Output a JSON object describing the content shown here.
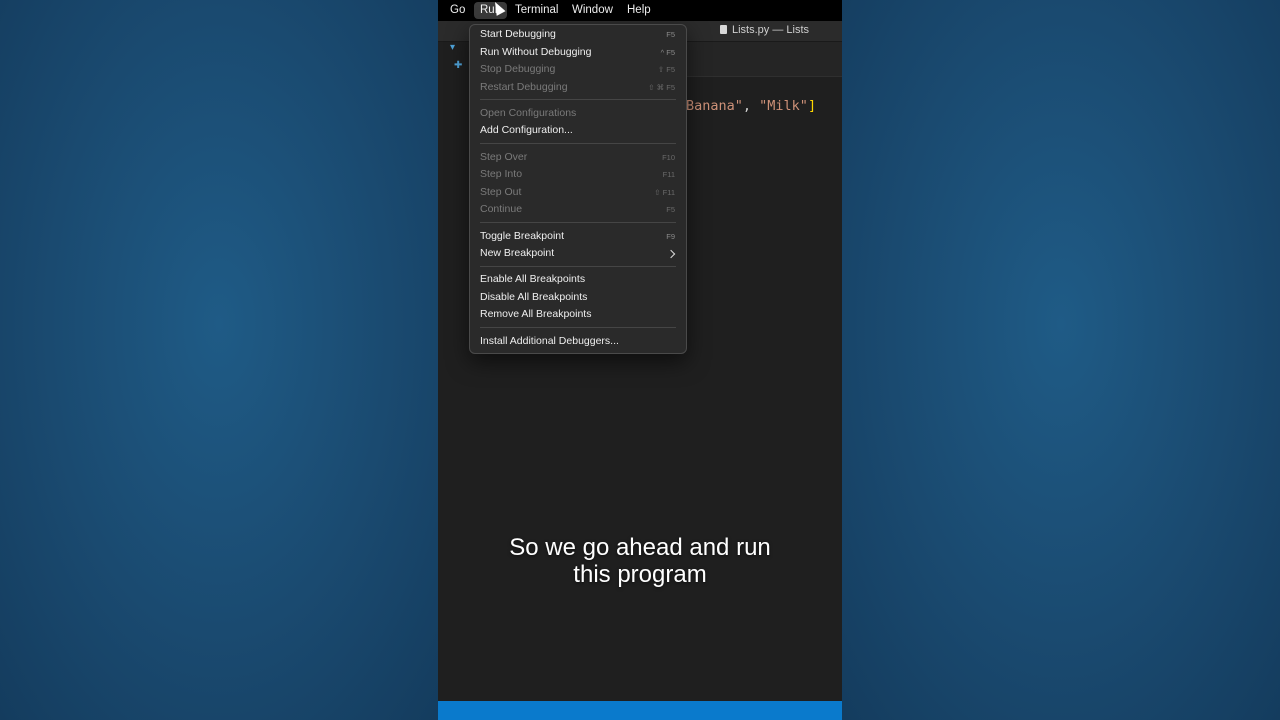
{
  "menubar": {
    "items": [
      "Go",
      "Run",
      "Terminal",
      "Window",
      "Help"
    ]
  },
  "titlebar": {
    "title": "Lists.py — Lists"
  },
  "editor": {
    "visible_code": {
      "str1": "Banana\"",
      "sep": ", ",
      "str2": "\"Milk\"",
      "close": "]"
    }
  },
  "run_menu": {
    "items": [
      {
        "label": "Start Debugging",
        "shortcut": "F5",
        "enabled": true
      },
      {
        "label": "Run Without Debugging",
        "shortcut": "^ F5",
        "enabled": true
      },
      {
        "label": "Stop Debugging",
        "shortcut": "⇧ F5",
        "enabled": false
      },
      {
        "label": "Restart Debugging",
        "shortcut": "⇧ ⌘ F5",
        "enabled": false
      },
      {
        "label": "Open Configurations",
        "shortcut": "",
        "enabled": false
      },
      {
        "label": "Add Configuration...",
        "shortcut": "",
        "enabled": true
      },
      {
        "label": "Step Over",
        "shortcut": "F10",
        "enabled": false
      },
      {
        "label": "Step Into",
        "shortcut": "F11",
        "enabled": false
      },
      {
        "label": "Step Out",
        "shortcut": "⇧ F11",
        "enabled": false
      },
      {
        "label": "Continue",
        "shortcut": "F5",
        "enabled": false
      },
      {
        "label": "Toggle Breakpoint",
        "shortcut": "F9",
        "enabled": true
      },
      {
        "label": "New Breakpoint",
        "shortcut": "",
        "enabled": true
      },
      {
        "label": "Enable All Breakpoints",
        "shortcut": "",
        "enabled": true
      },
      {
        "label": "Disable All Breakpoints",
        "shortcut": "",
        "enabled": true
      },
      {
        "label": "Remove All Breakpoints",
        "shortcut": "",
        "enabled": true
      },
      {
        "label": "Install Additional Debuggers...",
        "shortcut": "",
        "enabled": true
      }
    ]
  },
  "caption": {
    "line1": "So we go ahead and run",
    "line2": "this program"
  },
  "colors": {
    "background": "#1b4b72",
    "editor": "#1f1f1f",
    "statusbar": "#0a7acc",
    "string": "#ce9178"
  }
}
